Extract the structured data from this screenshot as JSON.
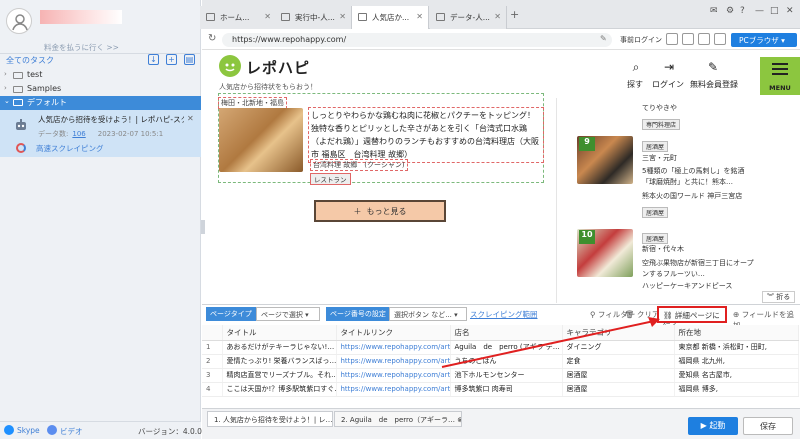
{
  "left": {
    "upgrade": "料金を払うに行く >>",
    "tasks_title": "全てのタスク",
    "tree": [
      "test",
      "Samples",
      "デフォルト"
    ],
    "task": {
      "title": "人気店から招待を受けよう！| レポハピ-スク…",
      "data_label": "データ数:",
      "data_count": "106",
      "date": "2023-02-07 10:5:1",
      "mode": "高速スクレイピング"
    },
    "footer": {
      "skype": "Skype",
      "video": "ビデオ",
      "version": "バージョン：4.0.0"
    }
  },
  "browser": {
    "tabs": [
      "ホーム...",
      "実行中-人...",
      "人気店か...",
      "データ-人..."
    ],
    "url": "https://www.repohappy.com/",
    "prelogin": "事前ログイン",
    "pc_browser": "PCブラウザ"
  },
  "site": {
    "logo": "レポハピ",
    "tagline": "人気店から招待状をもらおう！",
    "nav": [
      "探す",
      "ログイン",
      "無料会員登録"
    ],
    "menu": "MENU",
    "article": {
      "area": "梅田・北新地・福島",
      "desc": "しっとりやわらかな鶏むね肉に花椒とパクチーをトッピング！独特な香りとピリッとした辛さがあとを引く「台湾式口水鶏（よだれ鶏）」週替わりのランチもおすすめの台湾料理店（大阪市 福島区　台湾料理 故郷）",
      "tags": "台湾料理 故郷　(クーシャン)",
      "type": "レストラン"
    },
    "more": "もっと見る",
    "side": [
      {
        "line1": "てりやきや",
        "badge": "専門料理店"
      },
      {
        "rank": "9",
        "badge": "居酒屋",
        "area": "三宮・元町",
        "title1": "5種類の「極上の馬刺し」を銘酒「球磨焼酎」と共に！熊本…",
        "shop": "熊本火の国ワールド 神戸三宮店",
        "badge2": "居酒屋"
      },
      {
        "rank": "10",
        "badge": "居酒屋",
        "area": "新宿・代々木",
        "title1": "空飛ぶ果物店が新宿三丁目にオープンするフルーツい…",
        "shop": "ハッピーケーキアンドピース"
      }
    ],
    "collapse": "折る"
  },
  "toolbar": {
    "page_type_label": "ページタイプ",
    "page_type_value": "ページで選択",
    "page_num_label": "ページ番号の設定",
    "page_num_value": "選択ボタン など...",
    "scrape_range": "スクレイピング範囲",
    "filter": "フィルター",
    "clear": "クリア",
    "detail": "詳細ページに行く",
    "add_field": "フィールドを追加"
  },
  "table": {
    "headers": [
      "",
      "タイトル",
      "タイトルリンク",
      "店名",
      "キャラテゴリ",
      "所在地"
    ],
    "rows": [
      [
        "1",
        "あおるだけがテキーラじゃない!…",
        "https://www.repohappy.com/articl…",
        "Aguila　de　perro (アギラ デ…",
        "ダイニング",
        "東京都 新橋・浜松町・田町,"
      ],
      [
        "2",
        "愛情たっぷり! 栄養バランスばっ…",
        "https://www.repohappy.com/articl…",
        "うちのごはん",
        "定食",
        "福岡県 北九州,"
      ],
      [
        "3",
        "精肉店直営でリーズナブル。それ…",
        "https://www.repohappy.com/articl…",
        "池下ホルモンセンター",
        "居酒屋",
        "愛知県 名古屋市,"
      ],
      [
        "4",
        "ここは天国か!？博多駅筑紫口すぐ…",
        "https://www.repohappy.com/articl…",
        "博多筑紫口 肉寿司",
        "居酒屋",
        "福岡県 博多,"
      ]
    ]
  },
  "bottom": {
    "tab1": "1. 人気店から招待を受けよう！| レ…",
    "tab2": "2. Aguila　de　perro（アギーラ…",
    "start": "起動",
    "save": "保存"
  },
  "colors": {
    "accent": "#1e7fe0",
    "brand_green": "#8cc63f",
    "highlight_red": "#e02020"
  }
}
